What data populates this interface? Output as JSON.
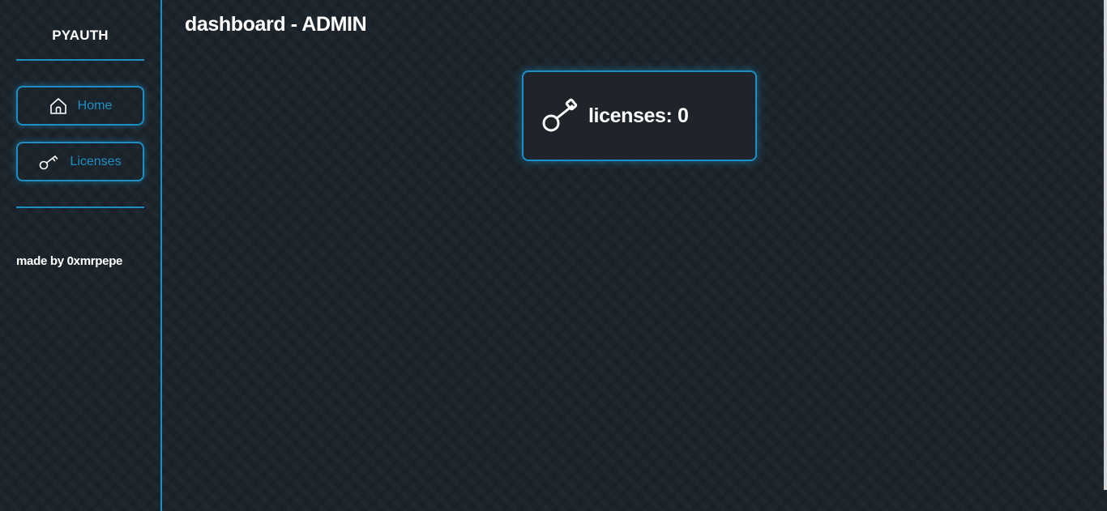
{
  "sidebar": {
    "brand": "PYAUTH",
    "nav": [
      {
        "label": "Home",
        "icon": "home-icon"
      },
      {
        "label": "Licenses",
        "icon": "key-icon"
      }
    ],
    "credit": "made by 0xmrpepe"
  },
  "main": {
    "title": "dashboard - ADMIN",
    "stat_card": {
      "icon": "key-icon",
      "text": "licenses: 0"
    }
  },
  "colors": {
    "accent": "#1b8fc4",
    "background": "#1c242b",
    "card_background": "#1f232a",
    "text": "#ffffff"
  }
}
